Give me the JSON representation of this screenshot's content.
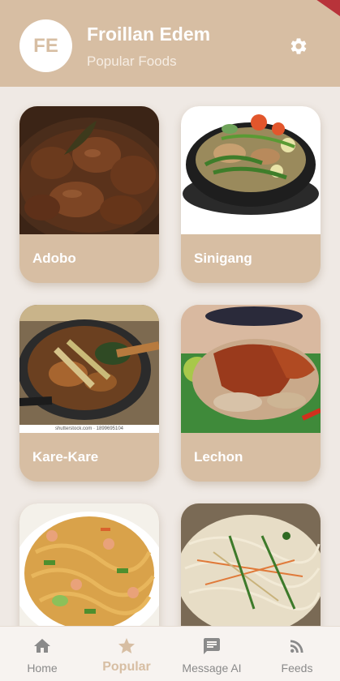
{
  "header": {
    "avatar_initials": "FE",
    "user_name": "Froillan Edem",
    "subtitle": "Popular Foods",
    "settings_icon": "gear-icon"
  },
  "colors": {
    "accent": "#d7bea3",
    "background": "#efe9e4",
    "nav_inactive": "#8a8a8a",
    "ribbon": "#b8333a"
  },
  "foods": [
    {
      "name": "Adobo"
    },
    {
      "name": "Sinigang"
    },
    {
      "name": "Kare-Kare",
      "image_caption": "shutterstock.com · 1899695104"
    },
    {
      "name": "Lechon"
    },
    {
      "name": ""
    },
    {
      "name": ""
    }
  ],
  "nav": {
    "active": "Popular",
    "items": [
      {
        "label": "Home",
        "icon": "home-icon"
      },
      {
        "label": "Popular",
        "icon": "star-icon"
      },
      {
        "label": "Message AI",
        "icon": "message-icon"
      },
      {
        "label": "Feeds",
        "icon": "rss-icon"
      }
    ]
  }
}
